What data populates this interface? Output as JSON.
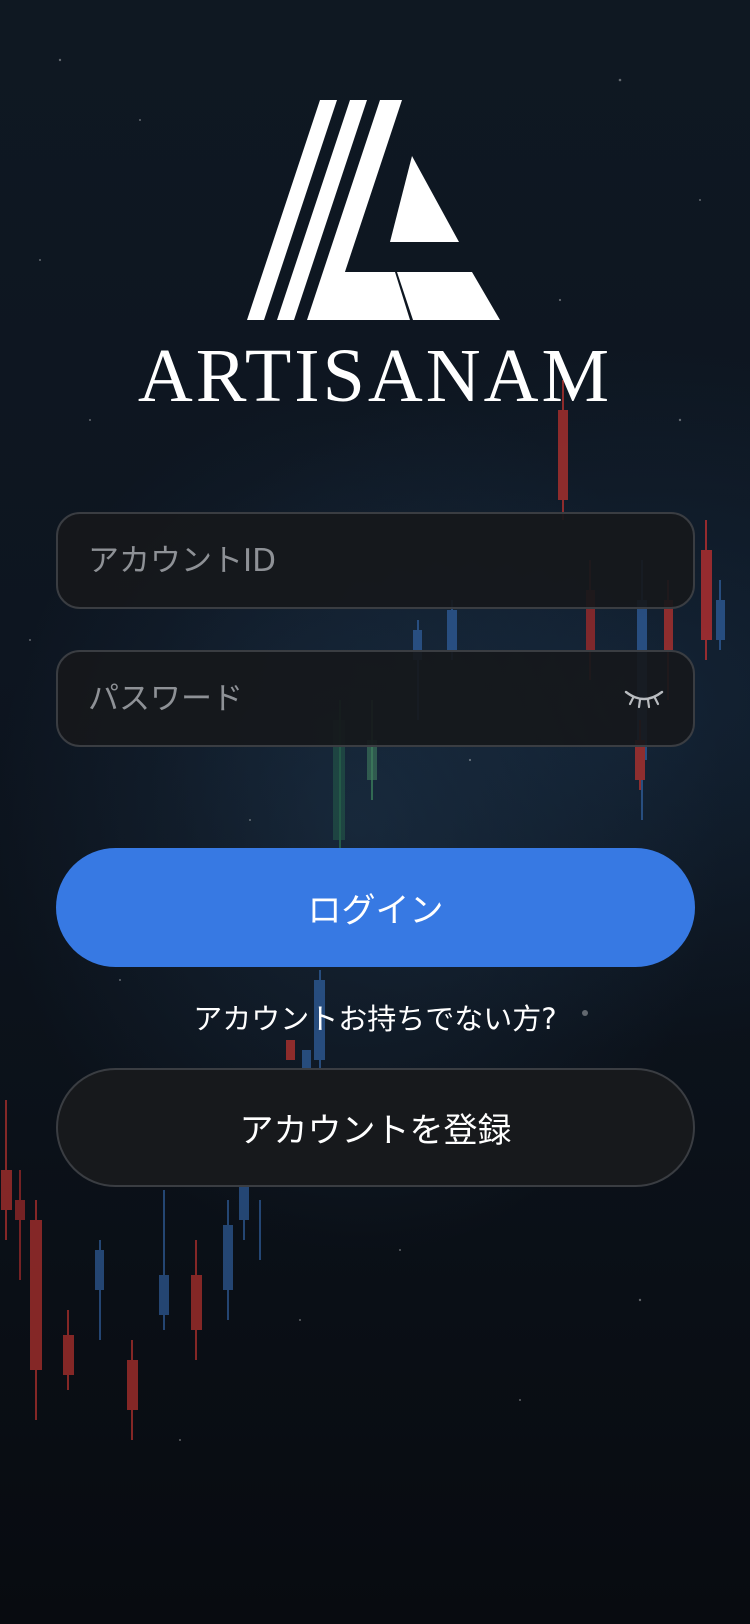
{
  "brand": {
    "logo_icon": "artisanam-a-logo-icon",
    "name": "ARTISANAM"
  },
  "form": {
    "account_id_placeholder": "アカウントID",
    "password_placeholder": "パスワード",
    "password_toggle_icon": "eye-closed-icon"
  },
  "actions": {
    "login_label": "ログイン",
    "no_account_text": "アカウントお持ちでない方?",
    "register_label": "アカウントを登録"
  },
  "colors": {
    "primary": "#3779e3",
    "background": "#0d1520",
    "field_background": "#16181b",
    "field_border": "#3a3d42"
  }
}
